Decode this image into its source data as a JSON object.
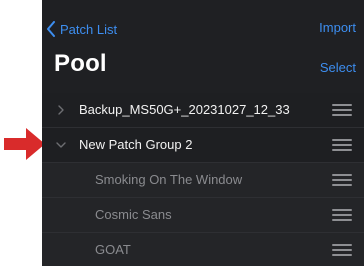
{
  "nav": {
    "back_label": "Patch List",
    "import_label": "Import",
    "title": "Pool",
    "select_label": "Select"
  },
  "rows": [
    {
      "label": "Backup_MS50G+_20231027_12_33",
      "expanded": false
    },
    {
      "label": "New Patch Group 2",
      "expanded": true
    },
    {
      "label": "Smoking On The Window"
    },
    {
      "label": "Cosmic Sans"
    },
    {
      "label": "GOAT"
    }
  ],
  "colors": {
    "accent": "#3d8ef0",
    "background": "#1b1b1d",
    "annotation_arrow": "#d92b2b"
  },
  "icons": {
    "back": "chevron-left-icon",
    "collapsed": "chevron-right-icon",
    "expanded": "chevron-down-icon",
    "reorder": "reorder-handle-icon",
    "annotation": "red-arrow-icon"
  }
}
